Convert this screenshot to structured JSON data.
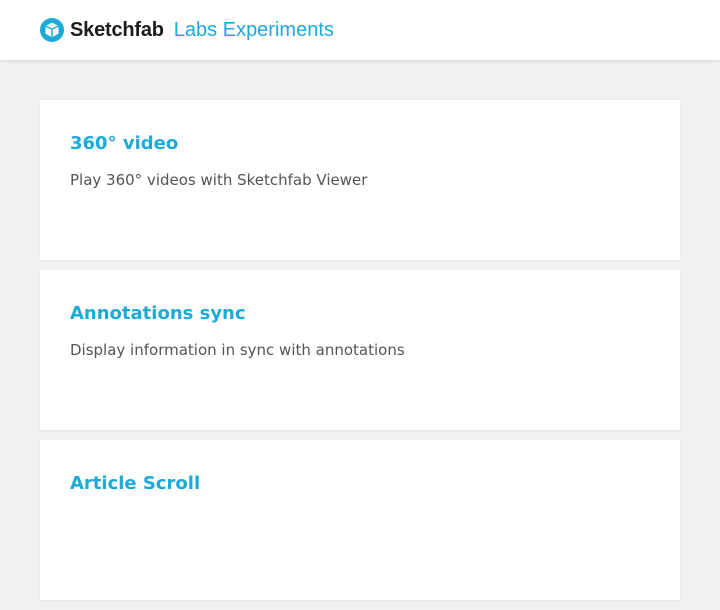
{
  "header": {
    "brand_name": "Sketchfab",
    "brand_sub": "Labs Experiments",
    "logo_icon": "sketchfab-cube-logo-icon",
    "accent_color": "#1caad9"
  },
  "experiments": [
    {
      "title": "360° video",
      "description": "Play 360° videos with Sketchfab Viewer"
    },
    {
      "title": "Annotations sync",
      "description": "Display information in sync with annotations"
    },
    {
      "title": "Article Scroll",
      "description": ""
    }
  ]
}
